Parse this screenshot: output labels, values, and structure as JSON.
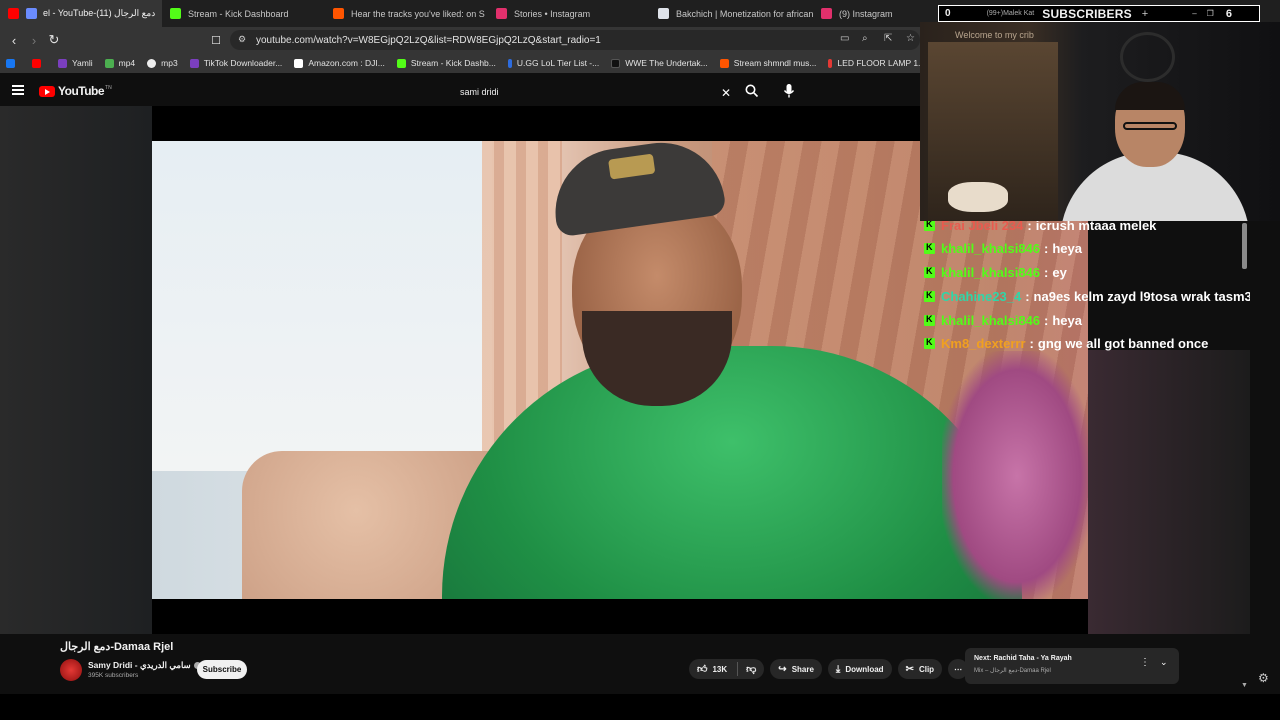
{
  "browser": {
    "tabs": [
      {
        "label": "ÿ¨Ø§Ù„ Ø§Ù„Ø±Ø¬Ø¹ Ø¯Ù…Ø¹ (11) YouTube-ÿ¬Ø§Ù„ - el",
        "display": "el - YouTube-دمع الرجال (11)",
        "favicon_color": "#ff0000",
        "active": true
      },
      {
        "display": "Stream - Kick Dashboard",
        "favicon_color": "#53fc18",
        "active": false
      },
      {
        "display": "Hear the tracks you've liked: on S",
        "favicon_color": "#ff5500",
        "active": false
      },
      {
        "display": "Stories • Instagram",
        "favicon_color": "#e1306c",
        "active": false
      },
      {
        "display": "Bakchich | Monetization for african c",
        "favicon_color": "#dfe3ea",
        "active": false
      },
      {
        "display": "(9) Instagram",
        "favicon_color": "#e1306c",
        "active": false
      }
    ],
    "url": "youtube.com/watch?v=W8EGjpQ2LzQ&list=RDW8EGjpQ2LzQ&start_radio=1",
    "bookmarks": [
      {
        "label": "",
        "color": "#1877f2"
      },
      {
        "label": "",
        "color": "#ff0000"
      },
      {
        "label": "Yamli",
        "color": "#7b3fbf"
      },
      {
        "label": "mp4",
        "color": "#4caf50"
      },
      {
        "label": "mp3",
        "color": "#eeeeee"
      },
      {
        "label": "TikTok Downloader...",
        "color": "#7b3fbf"
      },
      {
        "label": "Amazon.com : DJI...",
        "color": "#ffffff"
      },
      {
        "label": "Stream - Kick Dashb...",
        "color": "#53fc18"
      },
      {
        "label": "U.GG LoL Tier List -...",
        "color": "#2d6cdf"
      },
      {
        "label": "WWE The Undertak...",
        "color": "#111111"
      },
      {
        "label": "Stream shmndl mus...",
        "color": "#ff5500"
      },
      {
        "label": "LED FLOOR LAMP 1...",
        "color": "#e53935"
      }
    ]
  },
  "youtube": {
    "logo_text": "YouTube",
    "logo_tm": "TN",
    "search_value": "sami dridi",
    "video_title": "دمع الرجال-Damaa Rjel",
    "channel_name": "Samy Dridi - سامي الدريدي",
    "subscribers": "395K subscribers",
    "subscribe_label": "Subscribe",
    "likes": "13K",
    "share_label": "Share",
    "download_label": "Download",
    "clip_label": "Clip",
    "next_title": "Next: Rachid Taha - Ya Rayah",
    "next_sub": "Mix – دمع الرجال-Damaa Rjel"
  },
  "overlay": {
    "left_count": "0",
    "tab_hint": "(99+)Malek Kat",
    "subs_label": "SUBSCRIBERS",
    "plus": "+",
    "right_count": "6",
    "webcam_sign": "Welcome to my crib"
  },
  "chat": [
    {
      "user": "Frai Jbeli 234",
      "text": "icrush mtaaa melek",
      "user_color": "#e85b4f"
    },
    {
      "user": "khalil_khalsi846",
      "text": "heya",
      "user_color": "#53fc18"
    },
    {
      "user": "khalil_khalsi846",
      "text": "ey",
      "user_color": "#53fc18"
    },
    {
      "user": "Chahine23_4",
      "text": "na9es kelm zayd l9tosa wrak tasm3",
      "user_color": "#2fd6a8"
    },
    {
      "user": "khalil_khalsi846",
      "text": "heya",
      "user_color": "#53fc18"
    },
    {
      "user": "Km8_dexterrr",
      "text": "gng we all got banned once",
      "user_color": "#f0a020"
    }
  ]
}
